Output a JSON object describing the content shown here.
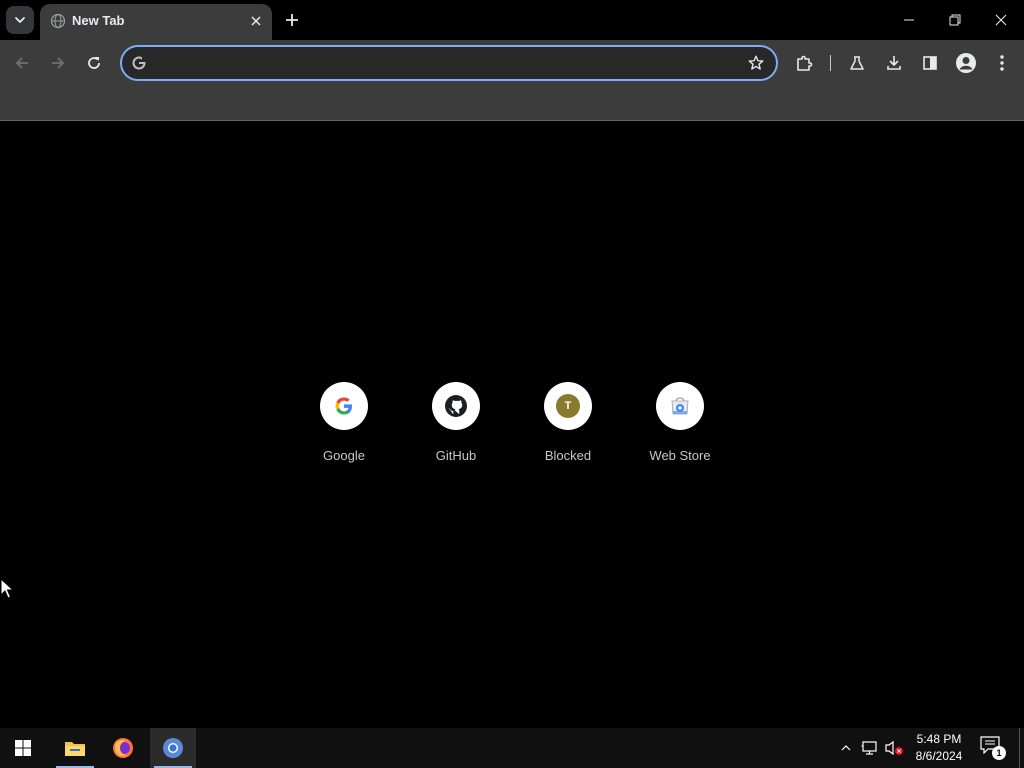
{
  "browser": {
    "tab": {
      "title": "New Tab"
    },
    "omnibox": {
      "value": "",
      "placeholder": ""
    }
  },
  "ntp": {
    "shortcuts": [
      {
        "label": "Google",
        "icon": "google-icon"
      },
      {
        "label": "GitHub",
        "icon": "github-icon"
      },
      {
        "label": "Blocked",
        "icon": "letter-t-icon",
        "letter": "T"
      },
      {
        "label": "Web Store",
        "icon": "web-store-icon"
      }
    ]
  },
  "taskbar": {
    "apps": [
      "start-icon",
      "file-explorer-icon",
      "firefox-icon",
      "chrome-icon"
    ],
    "clock": {
      "time": "5:48 PM",
      "date": "8/6/2024"
    },
    "notifications": {
      "count": "1"
    }
  },
  "colors": {
    "toolbar": "#3c3c3c",
    "omnibox_border": "#7cacf8",
    "page_background": "#000000",
    "taskbar": "#101010"
  }
}
